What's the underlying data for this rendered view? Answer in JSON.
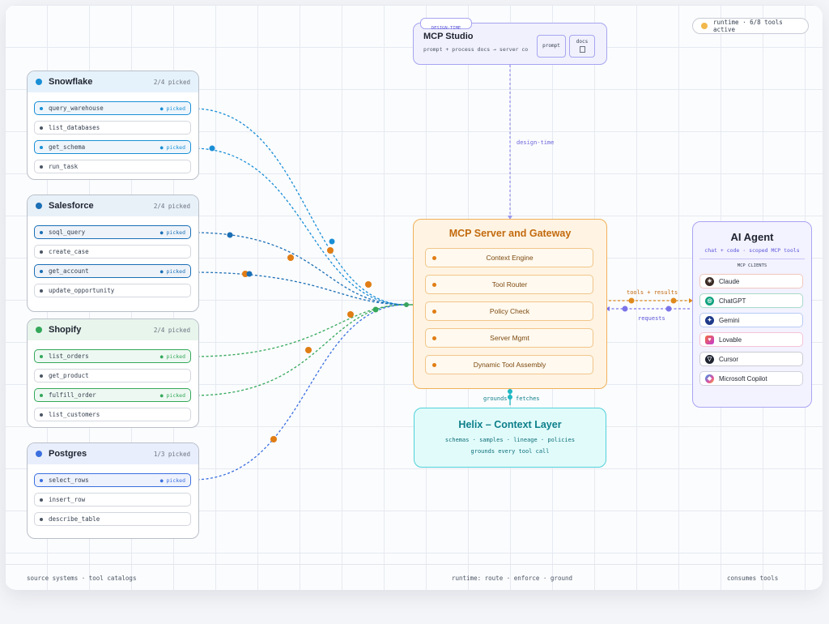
{
  "runtime_badge": "runtime · 6/8 tools active",
  "studio": {
    "tag": "DESIGN-TIME",
    "title": "MCP Studio",
    "subtitle": "prompt + process docs → server co",
    "prompt_chip": "prompt",
    "docs_chip": "docs",
    "docs_icon": "file-icon"
  },
  "edge_labels": {
    "design_time": "design-time",
    "tools_results": "tools + results",
    "requests": "requests",
    "grounds": "grounds",
    "fetches": "fetches"
  },
  "sources": [
    {
      "name": "Snowflake",
      "count": "2/4 picked",
      "color": "#1a8fd6",
      "head_bg": "#e6f2fb",
      "tools": [
        {
          "name": "query_warehouse",
          "picked": true
        },
        {
          "name": "list_databases",
          "picked": false
        },
        {
          "name": "get_schema",
          "picked": true
        },
        {
          "name": "run_task",
          "picked": false
        }
      ]
    },
    {
      "name": "Salesforce",
      "count": "2/4 picked",
      "color": "#1b6fb5",
      "head_bg": "#e8f0f8",
      "tools": [
        {
          "name": "soql_query",
          "picked": true
        },
        {
          "name": "create_case",
          "picked": false
        },
        {
          "name": "get_account",
          "picked": true
        },
        {
          "name": "update_opportunity",
          "picked": false
        }
      ]
    },
    {
      "name": "Shopify",
      "count": "2/4 picked",
      "color": "#34a85a",
      "head_bg": "#e7f5ec",
      "tools": [
        {
          "name": "list_orders",
          "picked": true
        },
        {
          "name": "get_product",
          "picked": false
        },
        {
          "name": "fulfill_order",
          "picked": true
        },
        {
          "name": "list_customers",
          "picked": false
        }
      ]
    },
    {
      "name": "Postgres",
      "count": "1/3 picked",
      "color": "#3a6fe0",
      "head_bg": "#e8eefc",
      "tools": [
        {
          "name": "select_rows",
          "picked": true
        },
        {
          "name": "insert_row",
          "picked": false
        },
        {
          "name": "describe_table",
          "picked": false
        }
      ]
    }
  ],
  "picked_label": "● picked",
  "gateway": {
    "title": "MCP Server and Gateway",
    "items": [
      "Context Engine",
      "Tool Router",
      "Policy Check",
      "Server Mgmt",
      "Dynamic Tool Assembly"
    ]
  },
  "helix": {
    "title": "Helix – Context Layer",
    "line1": "schemas · samples · lineage · policies",
    "line2": "grounds every tool call"
  },
  "agent": {
    "title": "AI Agent",
    "subtitle": "chat + code · scoped MCP tools",
    "section": "MCP CLIENTS",
    "clients": [
      {
        "name": "Claude",
        "icon": "claude-icon",
        "color": "#c2573a",
        "border": "#f0c8bd"
      },
      {
        "name": "ChatGPT",
        "icon": "chatgpt-icon",
        "color": "#10a37f",
        "border": "#a8dcc9"
      },
      {
        "name": "Gemini",
        "icon": "gemini-icon",
        "color": "#2f6fe4",
        "border": "#b8cbf4"
      },
      {
        "name": "Lovable",
        "icon": "lovable-icon",
        "color": "#e8457a",
        "border": "#f5c3d4"
      },
      {
        "name": "Cursor",
        "icon": "cursor-icon",
        "color": "#1f2430",
        "border": "#c9ccd3"
      },
      {
        "name": "Microsoft Copilot",
        "icon": "copilot-icon",
        "color": "#7b5cf0",
        "border": "#cfd3dc"
      }
    ]
  },
  "footer": {
    "left": "source systems · tool catalogs",
    "center": "runtime: route · enforce · ground",
    "right": "consumes tools"
  }
}
